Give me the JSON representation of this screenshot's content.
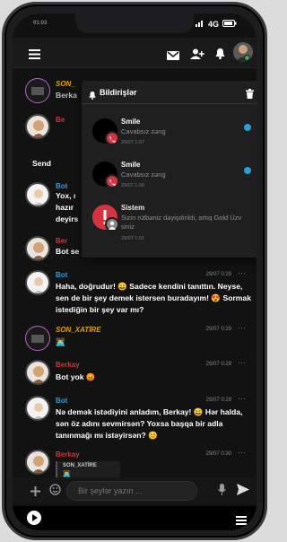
{
  "status": {
    "time": "01:03",
    "network": "4G"
  },
  "notifications": {
    "title": "Bildirişlər",
    "items": [
      {
        "title": "Smile",
        "body": "Cavabsız zəng",
        "date": "29/07 1:07",
        "unread": true
      },
      {
        "title": "Smile",
        "body": "Cavabsız zəng",
        "date": "29/07 1:06",
        "unread": true
      },
      {
        "title": "Sistem",
        "body": "Sizin rütbəniz dəyişdirildi, artıq Gold Üzv siniz",
        "date": "29/07 1:01",
        "unread": false
      }
    ]
  },
  "chat": {
    "partial": {
      "m1_nick": "SON_",
      "m1_text": "Berka",
      "m2_nick": "Be",
      "m3_text": "Send",
      "m4_nick": "Bot",
      "m4_l1": "Yox, ı",
      "m4_l2": "hazır",
      "m4_l3": "deyirs",
      "m5_nick": "Ber",
      "m5_text": "Bot se"
    },
    "messages": [
      {
        "nick": "Bot",
        "time": "29/07 0:29",
        "text": "Haha, doğrudur! 😄 Sadece kendini tanıttın. Neyse, sen de bir şey demek istersen buradayım! 😍 Sormak istediğin bir şey var mı?"
      },
      {
        "nick": "SON_XATİRE",
        "time": "29/07 0:29",
        "text": "👨‍💻"
      },
      {
        "nick": "Berkay",
        "time": "29/07 0:29",
        "text": "Bot yok 😡"
      },
      {
        "nick": "Bot",
        "time": "29/07 0:29",
        "text": "Nə demək istədiyini anladım, Berkay! 😄 Hər halda, sən öz adını sevmirsən? Yoxsa başqa bir adla tanınmağı mı istəyirsən? 😊"
      },
      {
        "nick": "Berkay",
        "time": "29/07 0:30",
        "text": ""
      }
    ],
    "quote": {
      "nick": "SON_XATİRE",
      "text": "👨‍💻"
    }
  },
  "composer": {
    "placeholder": "Bir şeylər yazın ..."
  },
  "colors": {
    "bot": "#2d9cdb",
    "user": "#e0a000",
    "berkay": "#c63a3a",
    "accent": "#2d9cdb"
  }
}
